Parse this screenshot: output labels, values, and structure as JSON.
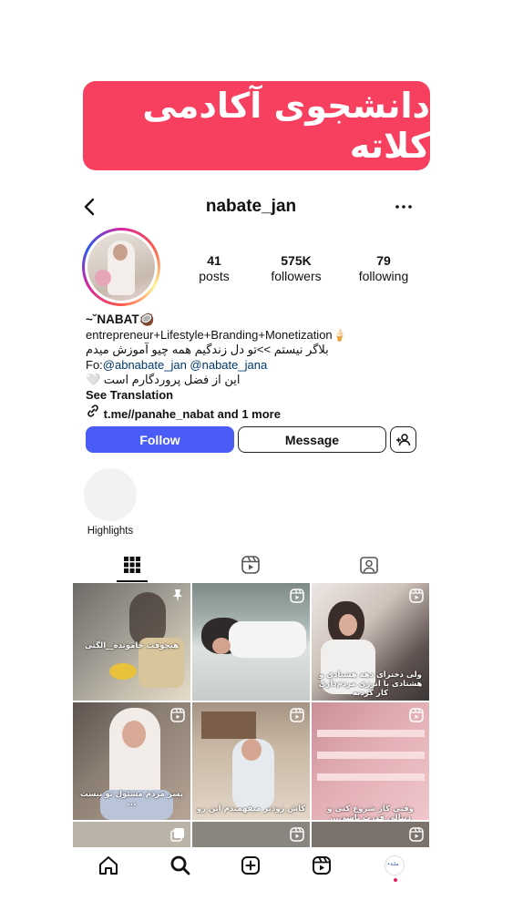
{
  "banner": {
    "text": "دانشجوی آکادمی کلاته",
    "color": "#f7405f"
  },
  "header": {
    "username": "nabate_jan",
    "back_icon": "chevron-left-icon",
    "more_icon": "more-horizontal-icon"
  },
  "stats": [
    {
      "value": "41",
      "label": "posts"
    },
    {
      "value": "575K",
      "label": "followers"
    },
    {
      "value": "79",
      "label": "following"
    }
  ],
  "bio": {
    "name": "~˘NABAT🥥",
    "line1": "entrepreneur+Lifestyle+Branding+Monetization🍦",
    "line2": "بلاگر نیستم >>تو دل زندگیم  همه چیو آموزش میدم",
    "fo_prefix": "Fo:",
    "mention1": "@abnabate_jan",
    "mention2": "@nabate_jana",
    "line4": "این از فضل پروردگارم است 🤍",
    "see_translation": "See Translation",
    "link": "t.me//panahe_nabat and 1 more"
  },
  "buttons": {
    "follow": "Follow",
    "message": "Message",
    "follow_color": "#4a5cf6"
  },
  "highlights": {
    "label": "Highlights"
  },
  "grid": {
    "captions": [
      "هیچوقت جامونده__الگتی",
      "",
      "ولی دخترای دهه هشتادی و هشتادی با انرژی مردم‌داری کار کردنه",
      "پسر مردم مسئول تو نیست ...",
      "کاش زودتر میفهمیدم این رو",
      "وقتی کار شروع کنی و دنبالی قدرت باشی..."
    ]
  }
}
